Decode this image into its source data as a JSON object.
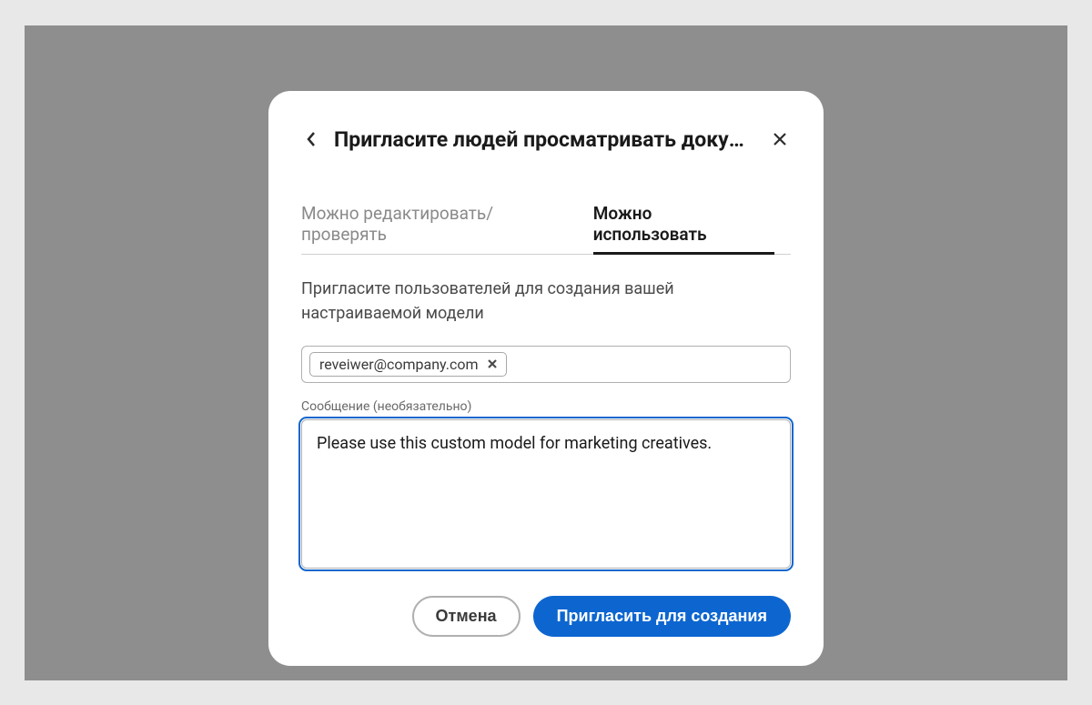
{
  "dialog": {
    "title": "Пригласите людей просматривать докум…",
    "tabs": {
      "edit": "Можно редактировать/проверять",
      "use": "Можно использовать"
    },
    "instruction": "Пригласите пользователей для создания вашей настраиваемой модели",
    "email_chip": "reveiwer@company.com",
    "message_label": "Сообщение (необязательно)",
    "message_value": "Please use this custom model for marketing creatives.",
    "buttons": {
      "cancel": "Отмена",
      "submit": "Пригласить для создания"
    }
  }
}
